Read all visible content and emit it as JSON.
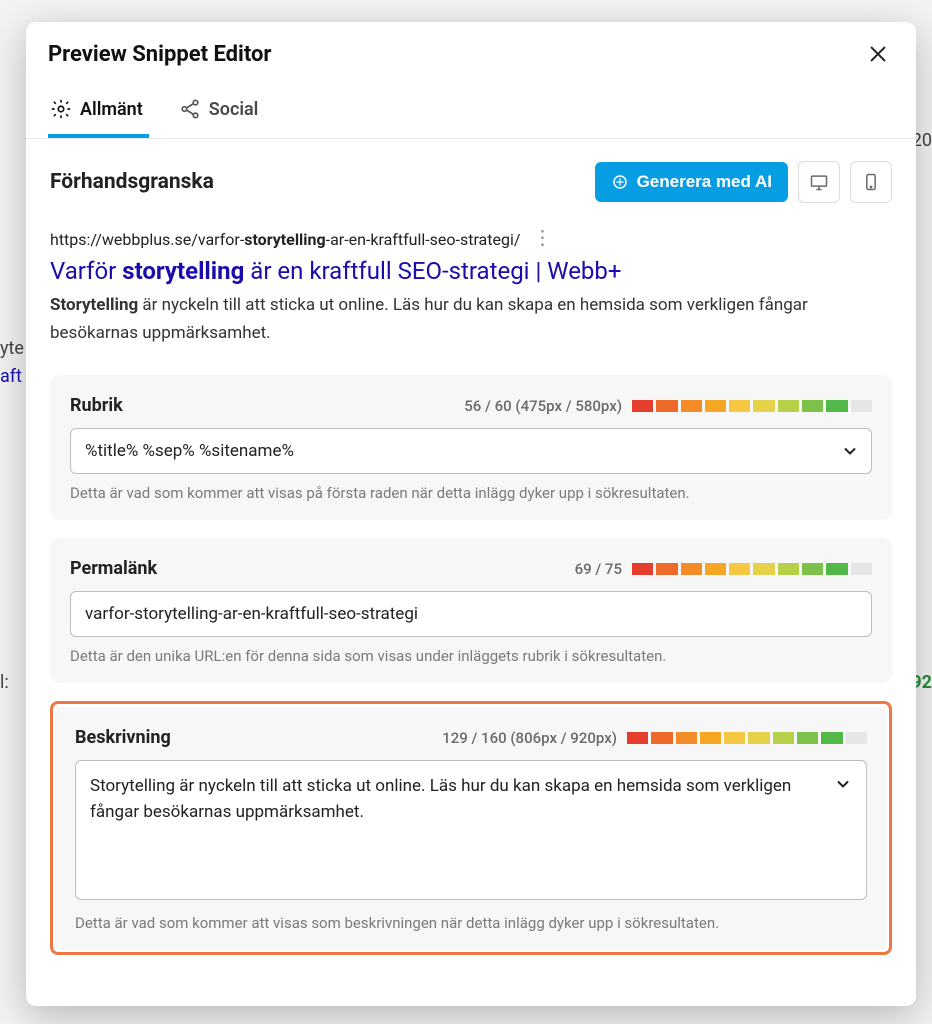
{
  "modal_title": "Preview Snippet Editor",
  "tabs": {
    "general": "Allmänt",
    "social": "Social"
  },
  "topbar": {
    "preview_label": "Förhandsgranska",
    "ai_button": "Generera med AI"
  },
  "preview": {
    "url_prefix": "https://webbplus.se/varfor-",
    "url_bold": "storytelling",
    "url_suffix": "-ar-en-kraftfull-seo-strategi/",
    "title_prefix": "Varför ",
    "title_bold": "storytelling",
    "title_suffix": " är en kraftfull SEO-strategi | Webb+",
    "desc_bold": "Storytelling",
    "desc_rest": " är nyckeln till att sticka ut online. Läs hur du kan skapa en hemsida som verkligen fångar besökarnas uppmärksamhet."
  },
  "rubrik": {
    "label": "Rubrik",
    "meta": "56 / 60 (475px / 580px)",
    "value": "%title% %sep% %sitename%",
    "help": "Detta är vad som kommer att visas på första raden när detta inlägg dyker upp i sökresultaten."
  },
  "permalink": {
    "label": "Permalänk",
    "meta": "69 / 75",
    "value": "varfor-storytelling-ar-en-kraftfull-seo-strategi",
    "help": "Detta är den unika URL:en för denna sida som visas under inläggets rubrik i sökresultaten."
  },
  "beskrivning": {
    "label": "Beskrivning",
    "meta": "129 / 160 (806px / 920px)",
    "value": "Storytelling är nyckeln till att sticka ut online. Läs hur du kan skapa en hemsida som verkligen fångar besökarnas uppmärksamhet.",
    "help": "Detta är vad som kommer att visas som beskrivningen när detta inlägg dyker upp i sökresultaten."
  }
}
